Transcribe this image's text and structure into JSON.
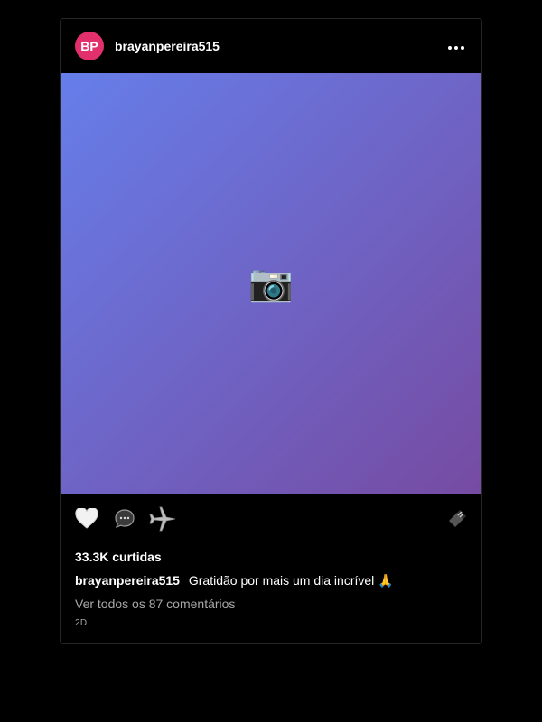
{
  "post": {
    "avatar_initials": "BP",
    "username": "brayanpereira515",
    "media_icon": "📷",
    "likes": "33.3K curtidas",
    "caption": {
      "username": "brayanpereira515",
      "text": "Gratidão por mais um dia incrível",
      "emoji": "🙏"
    },
    "comments_link": "Ver todos os 87 comentários",
    "timestamp": "2D"
  },
  "icons": {
    "more": "more-horizontal-icon",
    "like": "heart-icon",
    "comment": "comment-bubble-icon",
    "share": "airplane-share-icon",
    "save": "bookmark-icon",
    "media": "camera-icon"
  },
  "colors": {
    "background": "#000000",
    "avatar": "#e1306c",
    "gradient_start": "#667eea",
    "gradient_end": "#764ba2",
    "muted_text": "#a8a8a8"
  }
}
